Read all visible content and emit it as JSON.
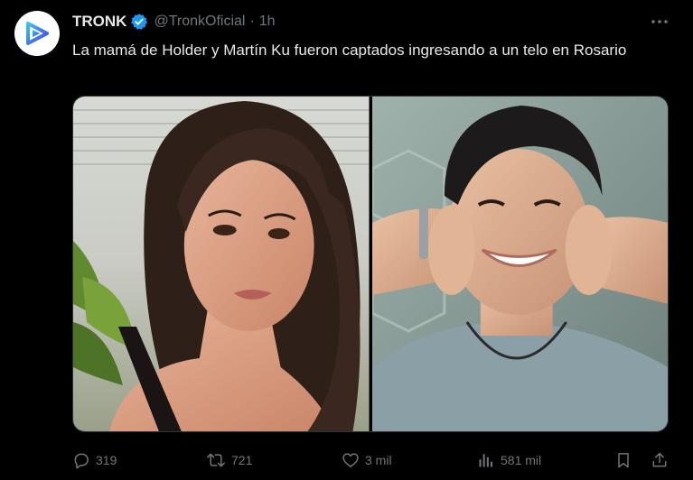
{
  "tweet": {
    "author": {
      "display_name": "TRONK",
      "handle": "@TronkOficial",
      "verified": true,
      "avatar_icon": "tronk-play-logo-icon"
    },
    "separator": "·",
    "time": "1h",
    "text": "La mamá de Holder y Martín Ku fueron captados ingresando a un telo en Rosario",
    "media": [
      {
        "kind": "photo",
        "subject": "woman-selfie"
      },
      {
        "kind": "photo",
        "subject": "man-smiling"
      }
    ]
  },
  "actions": {
    "reply": {
      "icon": "reply-icon",
      "count": "319"
    },
    "retweet": {
      "icon": "retweet-icon",
      "count": "721"
    },
    "like": {
      "icon": "heart-icon",
      "count": "3 mil"
    },
    "views": {
      "icon": "views-chart-icon",
      "count": "581 mil"
    },
    "bookmark": {
      "icon": "bookmark-icon"
    },
    "share": {
      "icon": "share-icon"
    }
  },
  "colors": {
    "background": "#000000",
    "text": "#e7e9ea",
    "muted": "#71767b",
    "verified": "#1d9bf0",
    "brand": "#3b57f5"
  }
}
